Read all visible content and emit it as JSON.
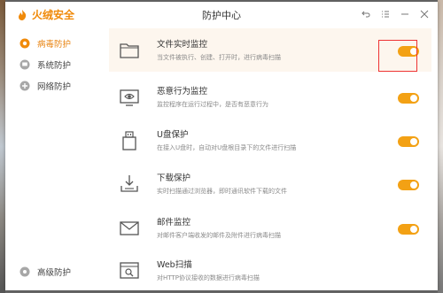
{
  "app": {
    "brand": "火绒安全",
    "title": "防护中心"
  },
  "colors": {
    "accent": "#f3a114",
    "brand": "#f08a0a",
    "highlight_box": "#e33333"
  },
  "titlebar": {
    "icons": [
      "back-icon",
      "menu-icon",
      "minimize-icon",
      "close-icon"
    ]
  },
  "sidebar": {
    "items": [
      {
        "label": "病毒防护",
        "icon": "virus-shield-icon",
        "active": true
      },
      {
        "label": "系统防护",
        "icon": "system-icon",
        "active": false
      },
      {
        "label": "网络防护",
        "icon": "network-icon",
        "active": false
      }
    ],
    "bottom": {
      "label": "高级防护",
      "icon": "advanced-icon"
    }
  },
  "rows": [
    {
      "title": "文件实时监控",
      "desc": "当文件被执行、创建、打开时，进行病毒扫描",
      "icon": "folder-icon",
      "enabled": true
    },
    {
      "title": "恶意行为监控",
      "desc": "监控程序在运行过程中，是否有恶意行为",
      "icon": "eye-monitor-icon",
      "enabled": true
    },
    {
      "title": "U盘保护",
      "desc": "在接入U盘时，自动对U盘根目录下的文件进行扫描",
      "icon": "usb-icon",
      "enabled": true
    },
    {
      "title": "下载保护",
      "desc": "实时扫描通过浏览器，即时通讯软件下载的文件",
      "icon": "download-tray-icon",
      "enabled": true
    },
    {
      "title": "邮件监控",
      "desc": "对邮件客户端收发的邮件及附件进行病毒扫描",
      "icon": "mail-icon",
      "enabled": true
    },
    {
      "title": "Web扫描",
      "desc": "对HTTP协议接收的数据进行病毒扫描",
      "icon": "web-scan-icon",
      "enabled": true
    }
  ]
}
